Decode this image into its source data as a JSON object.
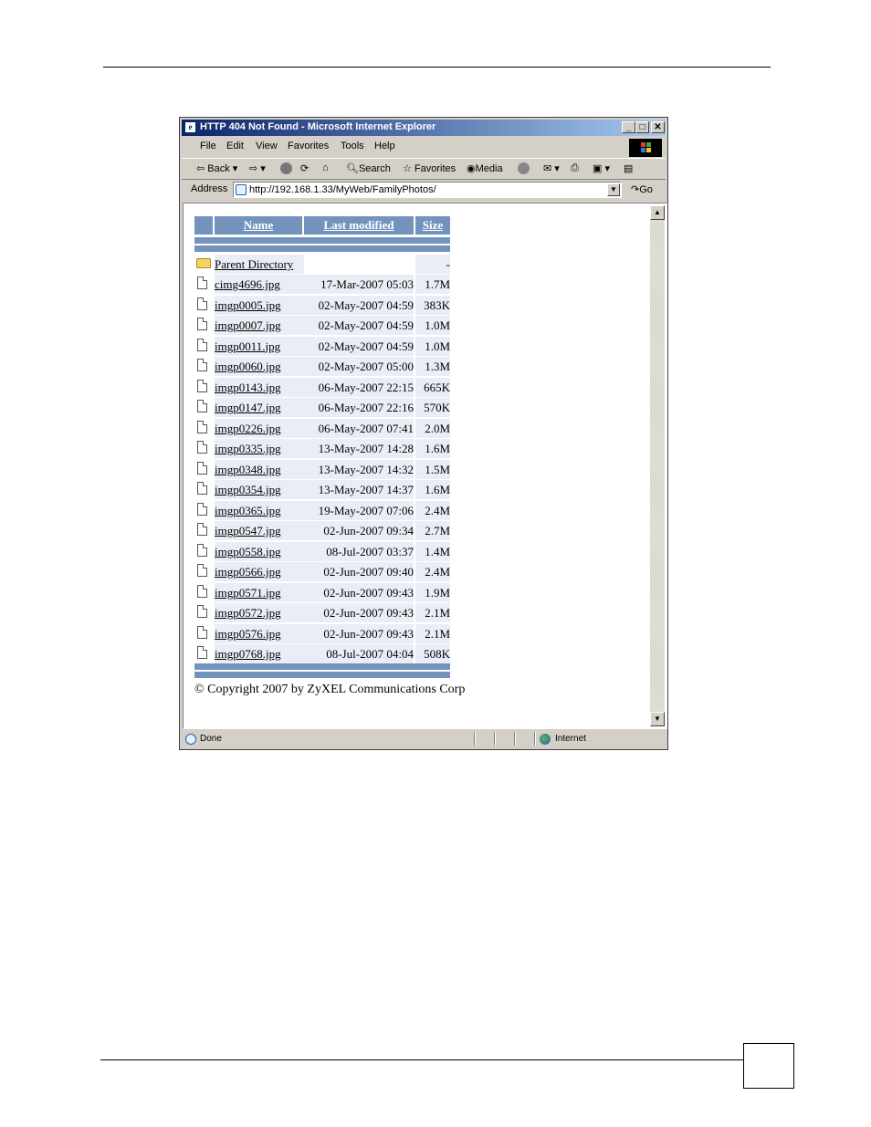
{
  "window": {
    "title": "HTTP 404 Not Found - Microsoft Internet Explorer",
    "min": "_",
    "max": "□",
    "close": "✕"
  },
  "menu": [
    "File",
    "Edit",
    "View",
    "Favorites",
    "Tools",
    "Help"
  ],
  "toolbar": {
    "back": "Back",
    "search": "Search",
    "favorites": "Favorites",
    "media": "Media"
  },
  "address": {
    "label": "Address",
    "url": "http://192.168.1.33/MyWeb/FamilyPhotos/",
    "go": "Go"
  },
  "listing": {
    "headers": {
      "name": "Name",
      "modified": "Last modified",
      "size": "Size"
    },
    "parent": {
      "name": "Parent Directory",
      "size": "-"
    },
    "files": [
      {
        "name": "cimg4696.jpg",
        "modified": "17-Mar-2007 05:03",
        "size": "1.7M"
      },
      {
        "name": "imgp0005.jpg",
        "modified": "02-May-2007 04:59",
        "size": "383K"
      },
      {
        "name": "imgp0007.jpg",
        "modified": "02-May-2007 04:59",
        "size": "1.0M"
      },
      {
        "name": "imgp0011.jpg",
        "modified": "02-May-2007 04:59",
        "size": "1.0M"
      },
      {
        "name": "imgp0060.jpg",
        "modified": "02-May-2007 05:00",
        "size": "1.3M"
      },
      {
        "name": "imgp0143.jpg",
        "modified": "06-May-2007 22:15",
        "size": "665K"
      },
      {
        "name": "imgp0147.jpg",
        "modified": "06-May-2007 22:16",
        "size": "570K"
      },
      {
        "name": "imgp0226.jpg",
        "modified": "06-May-2007 07:41",
        "size": "2.0M"
      },
      {
        "name": "imgp0335.jpg",
        "modified": "13-May-2007 14:28",
        "size": "1.6M"
      },
      {
        "name": "imgp0348.jpg",
        "modified": "13-May-2007 14:32",
        "size": "1.5M"
      },
      {
        "name": "imgp0354.jpg",
        "modified": "13-May-2007 14:37",
        "size": "1.6M"
      },
      {
        "name": "imgp0365.jpg",
        "modified": "19-May-2007 07:06",
        "size": "2.4M"
      },
      {
        "name": "imgp0547.jpg",
        "modified": "02-Jun-2007 09:34",
        "size": "2.7M"
      },
      {
        "name": "imgp0558.jpg",
        "modified": "08-Jul-2007 03:37",
        "size": "1.4M"
      },
      {
        "name": "imgp0566.jpg",
        "modified": "02-Jun-2007 09:40",
        "size": "2.4M"
      },
      {
        "name": "imgp0571.jpg",
        "modified": "02-Jun-2007 09:43",
        "size": "1.9M"
      },
      {
        "name": "imgp0572.jpg",
        "modified": "02-Jun-2007 09:43",
        "size": "2.1M"
      },
      {
        "name": "imgp0576.jpg",
        "modified": "02-Jun-2007 09:43",
        "size": "2.1M"
      },
      {
        "name": "imgp0768.jpg",
        "modified": "08-Jul-2007 04:04",
        "size": "508K"
      }
    ],
    "copyright": "© Copyright 2007 by ZyXEL Communications Corp"
  },
  "status": {
    "text": "Done",
    "zone": "Internet"
  },
  "colors": {
    "header_bg": "#7393bd",
    "title_gradient_start": "#0a246a",
    "title_gradient_end": "#a6caf0",
    "row_shade": "#e9eef6"
  }
}
